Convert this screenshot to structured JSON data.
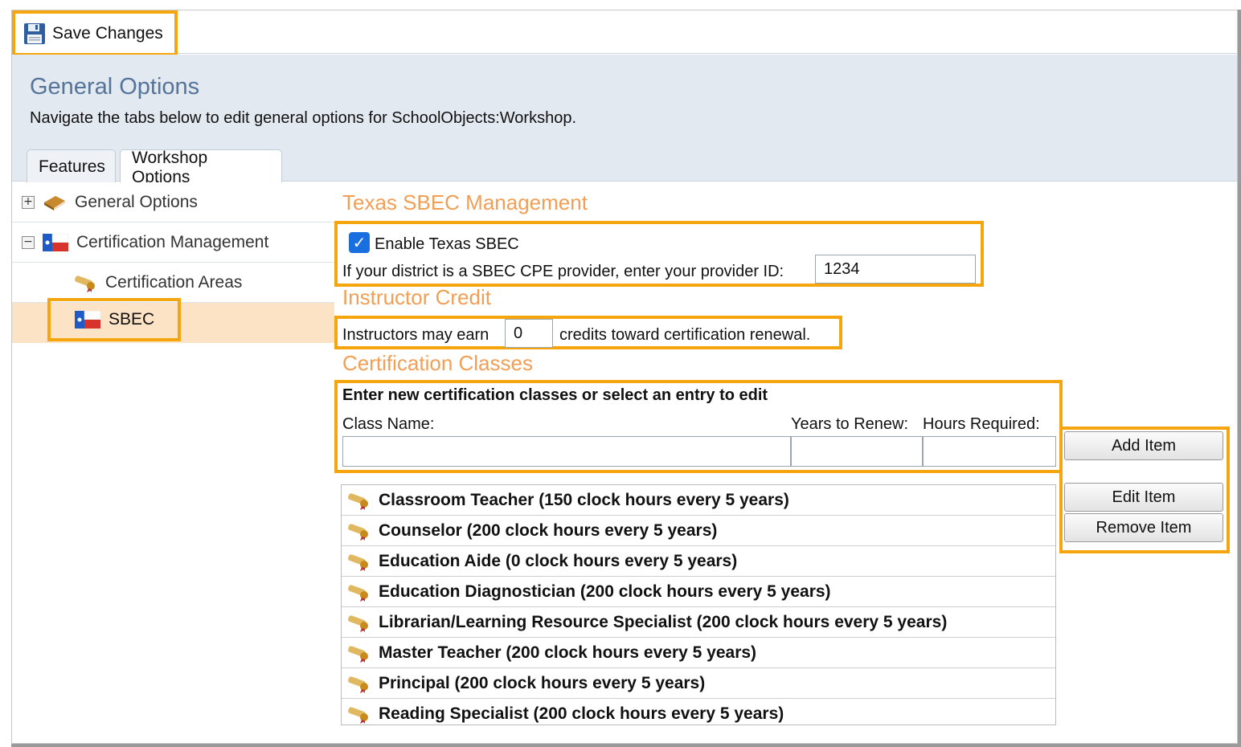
{
  "toolbar": {
    "save_label": "Save Changes"
  },
  "header": {
    "title": "General Options",
    "subtitle": "Navigate the tabs below to edit general options for SchoolObjects:Workshop.",
    "tabs": [
      {
        "label": "Features"
      },
      {
        "label": "Workshop Options"
      }
    ]
  },
  "tree": {
    "items": [
      {
        "label": "General Options",
        "toggle": "+"
      },
      {
        "label": "Certification Management",
        "toggle": "−"
      },
      {
        "label": "Certification Areas"
      },
      {
        "label": "SBEC"
      }
    ]
  },
  "sbec": {
    "section_title": "Texas SBEC Management",
    "enable_label": "Enable Texas SBEC",
    "enabled": true,
    "provider_label": "If your district is a SBEC CPE provider, enter your provider ID:",
    "provider_id": "1234"
  },
  "instructor": {
    "section_title": "Instructor Credit",
    "prefix": "Instructors may earn",
    "credits": "0",
    "suffix": "credits toward certification renewal."
  },
  "classes": {
    "section_title": "Certification Classes",
    "instruction": "Enter new certification classes or select an entry to edit",
    "col_class_name": "Class Name:",
    "col_years": "Years to Renew:",
    "col_hours": "Hours Required:",
    "add_label": "Add Item",
    "edit_label": "Edit Item",
    "remove_label": "Remove Item",
    "items": [
      "Classroom Teacher (150 clock hours every 5 years)",
      "Counselor (200 clock hours every 5 years)",
      "Education Aide (0 clock hours every 5 years)",
      "Education Diagnostician (200 clock hours every 5 years)",
      "Librarian/Learning Resource Specialist (200 clock hours every 5 years)",
      "Master Teacher (200 clock hours every 5 years)",
      "Principal (200 clock hours every 5 years)",
      "Reading Specialist (200 clock hours every 5 years)"
    ]
  },
  "colors": {
    "highlight": "#f5a60f",
    "section": "#f29f56",
    "title": "#55749a",
    "selected": "#fde3c6"
  }
}
